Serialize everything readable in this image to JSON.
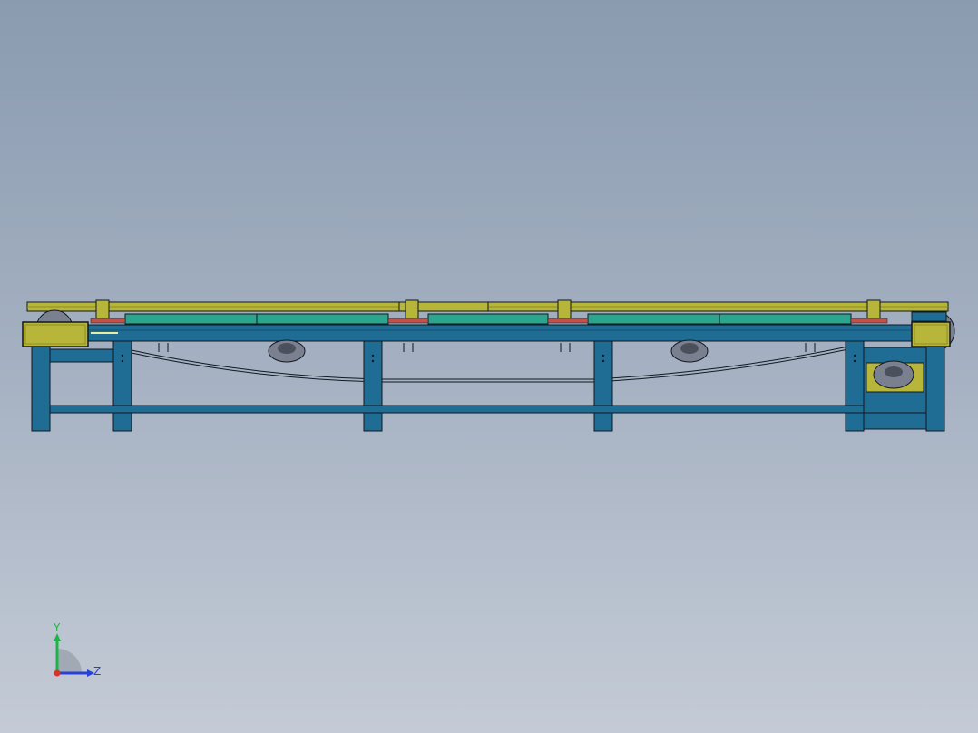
{
  "view": {
    "background_top": "#8a9bb0",
    "background_bottom": "#c4cbd6",
    "model_colors": {
      "frame": "#1f6d94",
      "frame_dark": "#15506e",
      "rail": "#b8b63a",
      "rail_dark": "#8f8d24",
      "belt": "#2aa58e",
      "accent": "#c0524a",
      "motor": "#7a8090",
      "outline": "#101820"
    }
  },
  "triad": {
    "y_label": "Y",
    "z_label": "Z",
    "y_color": "#22b24a",
    "z_color": "#2a3fd8",
    "x_color": "#d8322a"
  }
}
